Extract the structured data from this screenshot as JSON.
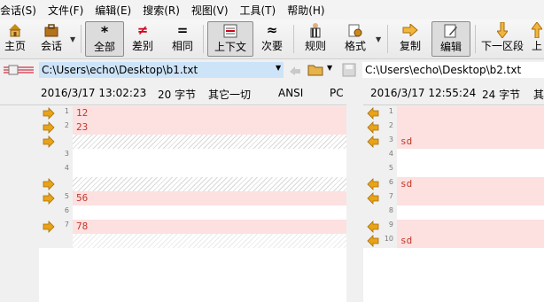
{
  "menu": [
    "会话(S)",
    "文件(F)",
    "编辑(E)",
    "搜索(R)",
    "视图(V)",
    "工具(T)",
    "帮助(H)"
  ],
  "toolbar": {
    "home": "主页",
    "session": "会话",
    "all": "全部",
    "diff": "差别",
    "same": "相同",
    "context": "上下文",
    "minor": "次要",
    "rules": "规则",
    "format": "格式",
    "copy": "复制",
    "edit": "编辑",
    "next_section": "下一区段",
    "prev": "上"
  },
  "left": {
    "path": "C:\\Users\\echo\\Desktop\\b1.txt",
    "datetime": "2016/3/17 13:02:23",
    "size": "20 字节",
    "other": "其它一切",
    "encoding": "ANSI",
    "lineend": "PC",
    "lines": [
      {
        "num": "1",
        "text": "12",
        "kind": "pink",
        "arrow": true
      },
      {
        "num": "2",
        "text": "23",
        "kind": "pink",
        "arrow": true
      },
      {
        "num": "",
        "text": "",
        "kind": "hatch",
        "arrow": true
      },
      {
        "num": "3",
        "text": "",
        "kind": "white",
        "arrow": false
      },
      {
        "num": "4",
        "text": "",
        "kind": "white",
        "arrow": false
      },
      {
        "num": "",
        "text": "",
        "kind": "hatch",
        "arrow": true
      },
      {
        "num": "5",
        "text": "56",
        "kind": "pink",
        "arrow": true
      },
      {
        "num": "6",
        "text": "",
        "kind": "white",
        "arrow": false
      },
      {
        "num": "7",
        "text": "78",
        "kind": "pink",
        "arrow": true
      },
      {
        "num": "",
        "text": "",
        "kind": "hatchlight",
        "arrow": false
      }
    ]
  },
  "right": {
    "path": "C:\\Users\\echo\\Desktop\\b2.txt",
    "datetime": "2016/3/17 12:55:24",
    "size": "24 字节",
    "other": "其",
    "lines": [
      {
        "num": "1",
        "text": "",
        "kind": "pink",
        "arrow": true
      },
      {
        "num": "2",
        "text": "",
        "kind": "pink",
        "arrow": true
      },
      {
        "num": "3",
        "text": "sd",
        "kind": "pink",
        "arrow": true
      },
      {
        "num": "4",
        "text": "",
        "kind": "white",
        "arrow": false
      },
      {
        "num": "5",
        "text": "",
        "kind": "white",
        "arrow": false
      },
      {
        "num": "6",
        "text": "sd",
        "kind": "pink",
        "arrow": true
      },
      {
        "num": "7",
        "text": "",
        "kind": "pink",
        "arrow": true
      },
      {
        "num": "8",
        "text": "",
        "kind": "white",
        "arrow": false
      },
      {
        "num": "9",
        "text": "",
        "kind": "pink",
        "arrow": true
      },
      {
        "num": "10",
        "text": "sd",
        "kind": "pink",
        "arrow": true
      }
    ]
  },
  "colors": {
    "diff_bg": "#fde0e0",
    "diff_text": "#c0392b",
    "arrow": "#e8a317",
    "path_highlight": "#cde3f7"
  }
}
